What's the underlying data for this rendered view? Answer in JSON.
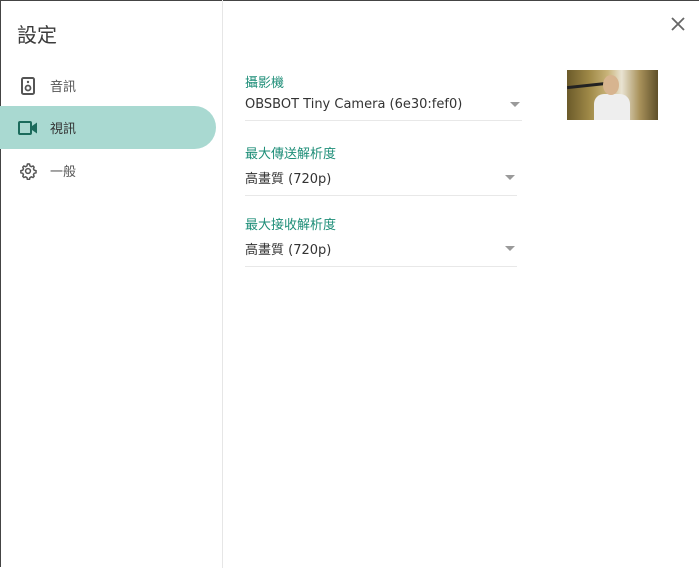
{
  "dialog": {
    "title": "設定",
    "close_icon": "close-icon"
  },
  "sidebar": {
    "items": [
      {
        "label": "音訊",
        "icon": "speaker-icon",
        "active": false
      },
      {
        "label": "視訊",
        "icon": "videocam-icon",
        "active": true
      },
      {
        "label": "一般",
        "icon": "gear-icon",
        "active": false
      }
    ]
  },
  "video": {
    "camera": {
      "label": "攝影機",
      "value": "OBSBOT Tiny Camera (6e30:fef0)"
    },
    "send_resolution": {
      "label": "最大傳送解析度",
      "value": "高畫質 (720p)"
    },
    "receive_resolution": {
      "label": "最大接收解析度",
      "value": "高畫質 (720p)"
    }
  },
  "colors": {
    "accent": "#1e8e78",
    "active_bg": "#a9d9d1"
  }
}
